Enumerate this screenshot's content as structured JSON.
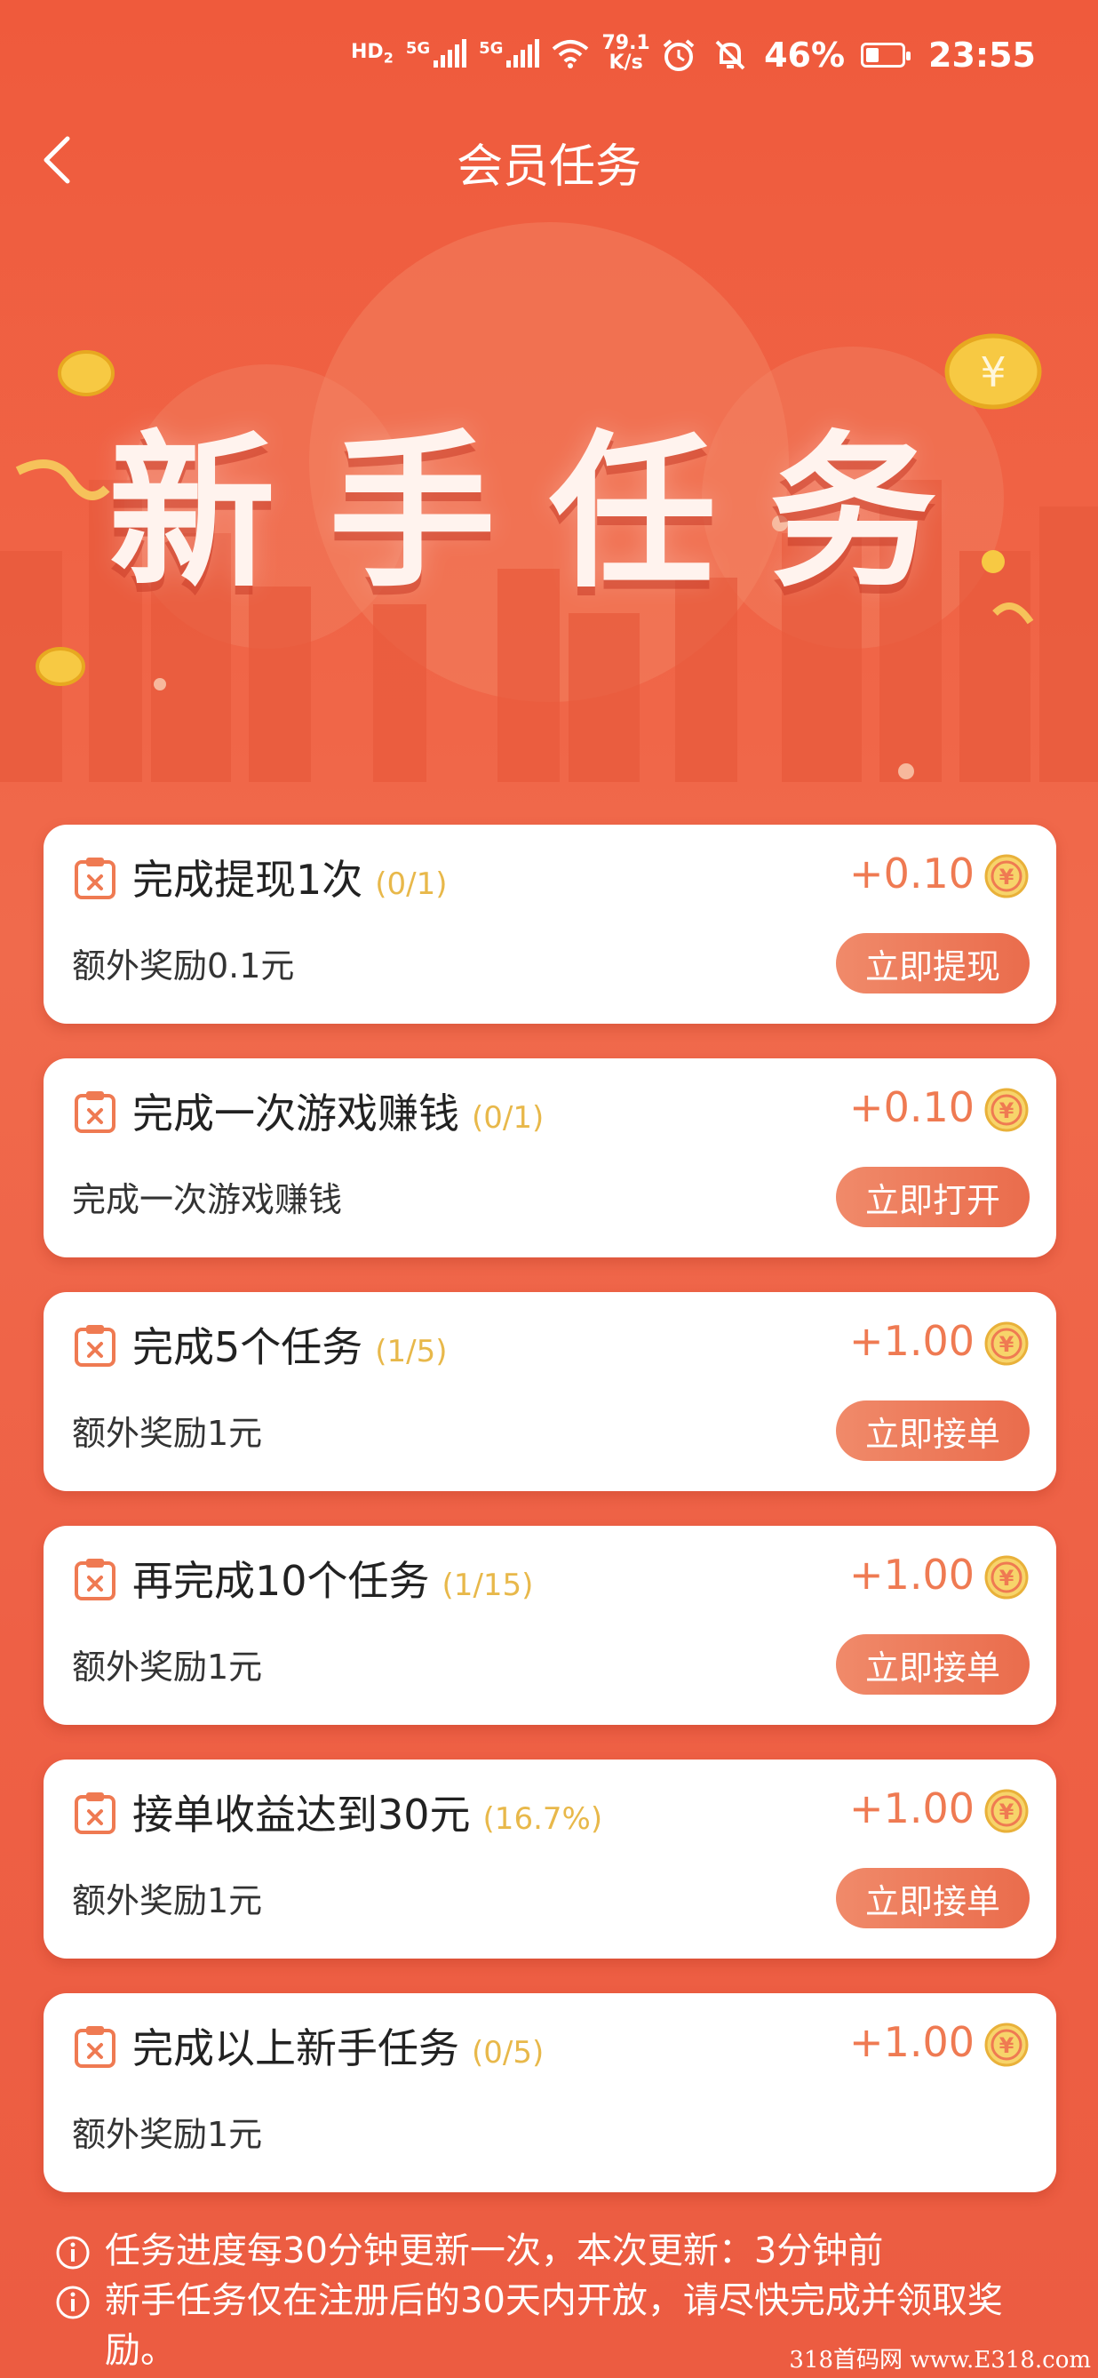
{
  "status_bar": {
    "hd_label": "HD",
    "hd_sub": "2",
    "sim1_label": "5G",
    "sim2_label": "5G",
    "net_speed_value": "79.1",
    "net_speed_unit": "K/s",
    "battery_text": "46%",
    "battery_level": 0.46,
    "time": "23:55",
    "icons": [
      "alarm-icon",
      "mute-bell-icon",
      "wifi-icon",
      "battery-icon"
    ]
  },
  "header": {
    "title": "会员任务",
    "back_icon": "back-chevron-icon"
  },
  "hero": {
    "banner_text": "新手任务"
  },
  "tasks": [
    {
      "title": "完成提现1次",
      "progress": "(0/1)",
      "reward": "+0.10",
      "desc": "额外奖励0.1元",
      "button": "立即提现"
    },
    {
      "title": "完成一次游戏赚钱",
      "progress": "(0/1)",
      "reward": "+0.10",
      "desc": "完成一次游戏赚钱",
      "button": "立即打开"
    },
    {
      "title": "完成5个任务",
      "progress": "(1/5)",
      "reward": "+1.00",
      "desc": "额外奖励1元",
      "button": "立即接单"
    },
    {
      "title": "再完成10个任务",
      "progress": "(1/15)",
      "reward": "+1.00",
      "desc": "额外奖励1元",
      "button": "立即接单"
    },
    {
      "title": "接单收益达到30元",
      "progress": "(16.7%)",
      "reward": "+1.00",
      "desc": "额外奖励1元",
      "button": "立即接单"
    },
    {
      "title": "完成以上新手任务",
      "progress": "(0/5)",
      "reward": "+1.00",
      "desc": "额外奖励1元",
      "button": ""
    }
  ],
  "notes": [
    "任务进度每30分钟更新一次，本次更新：3分钟前",
    "新手任务仅在注册后的30天内开放，请尽快完成并领取奖励。"
  ],
  "watermark": "318首码网 www.E318.com",
  "colors": {
    "background": "#ef5a3c",
    "accent": "#ef7a52",
    "progress": "#e8b84a",
    "button": "#ea6c4c",
    "coin": "#f3c640"
  }
}
